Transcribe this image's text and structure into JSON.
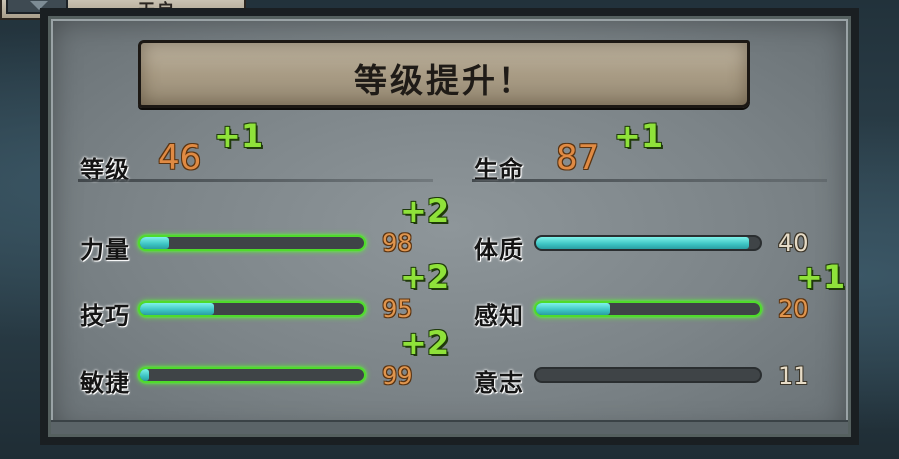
{
  "top_tab": {
    "icon": "ribbon-icon",
    "label": "天启"
  },
  "banner": {
    "title": "等级提升！"
  },
  "level": {
    "label": "等级",
    "value": "46",
    "gain": "+1"
  },
  "life": {
    "label": "生命",
    "value": "87",
    "gain": "+1"
  },
  "stats_left": [
    {
      "label": "力量",
      "value": "98",
      "gain": "+2",
      "fill": 0.13
    },
    {
      "label": "技巧",
      "value": "95",
      "gain": "+2",
      "fill": 0.33
    },
    {
      "label": "敏捷",
      "value": "99",
      "gain": "+2",
      "fill": 0.04
    }
  ],
  "stats_right": [
    {
      "label": "体质",
      "value": "40",
      "gain": "",
      "fill": 0.95
    },
    {
      "label": "感知",
      "value": "20",
      "gain": "+1",
      "fill": 0.33
    },
    {
      "label": "意志",
      "value": "11",
      "gain": "",
      "fill": 0.0
    }
  ],
  "colors": {
    "value_orange": "#e08a43",
    "gain_green": "#8fe23a",
    "bar_teal": "#3cc3c2",
    "bar_glow": "#4fdb2b"
  }
}
